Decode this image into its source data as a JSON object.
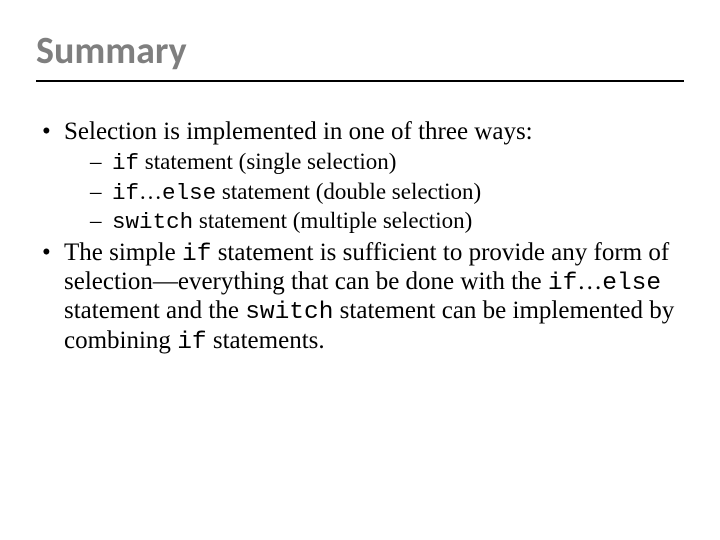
{
  "title": "Summary",
  "bullets": {
    "b1": {
      "text": "Selection is implemented in one of three ways:",
      "sub": {
        "s1": {
          "code": "if",
          "tail": " statement (single selection)"
        },
        "s2": {
          "code1": "if",
          "mid": "…",
          "code2": "else",
          "tail": " statement (double selection)"
        },
        "s3": {
          "code": "switch",
          "tail": " statement (multiple selection)"
        }
      }
    },
    "b2": {
      "t1": "The simple ",
      "c1": "if",
      "t2": " statement is sufficient to provide any form of selection—everything that can be done with the ",
      "c2": "if",
      "t3": "…",
      "c3": "else",
      "t4": " statement and the ",
      "c4": "switch",
      "t5": " statement can be implemented by combining ",
      "c5": "if",
      "t6": " statements."
    }
  }
}
